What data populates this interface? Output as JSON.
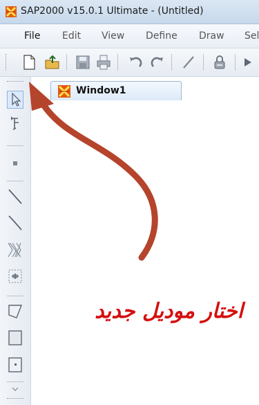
{
  "window": {
    "title": "SAP2000 v15.0.1 Ultimate  - (Untitled)"
  },
  "menu": {
    "items": [
      {
        "label": "File",
        "active": true
      },
      {
        "label": "Edit"
      },
      {
        "label": "View"
      },
      {
        "label": "Define"
      },
      {
        "label": "Draw"
      },
      {
        "label": "Sel"
      }
    ]
  },
  "toolbar": {
    "buttons": [
      "new-model-icon",
      "open-icon",
      "save-icon",
      "print-icon",
      "undo-icon",
      "redo-icon",
      "pencil-icon",
      "lock-icon",
      "run-icon"
    ]
  },
  "left_tools": {
    "buttons": [
      "pointer-icon",
      "reshaper-icon",
      "joint-icon",
      "frame-icon",
      "cable-icon",
      "tendon-icon",
      "link-icon",
      "poly-area-icon",
      "rect-area-icon",
      "quick-area-icon"
    ]
  },
  "tabs": [
    {
      "label": "Window1",
      "icon": "sap-window-icon"
    }
  ],
  "annotation": {
    "caption": "اختار موديل جديد",
    "color": "#d51010",
    "arrow_color": "#b5442c"
  }
}
